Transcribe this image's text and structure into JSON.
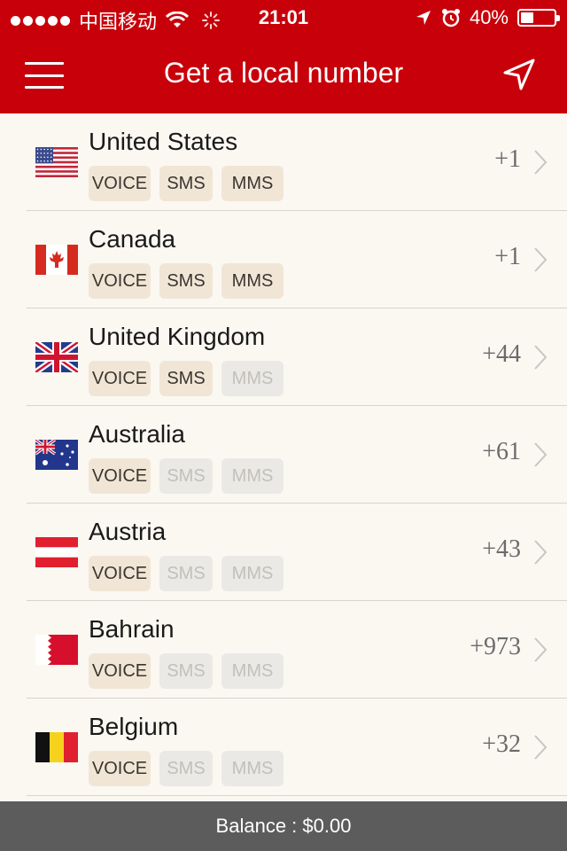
{
  "status_bar": {
    "carrier": "中国移动",
    "time": "21:01",
    "battery": "40%",
    "battery_level": 0.4
  },
  "header": {
    "title": "Get a local number",
    "menu_icon": "hamburger-menu-icon",
    "locate_icon": "location-arrow-icon"
  },
  "countries": [
    {
      "name": "United States",
      "code": "+1",
      "flag": "us",
      "voice": "VOICE",
      "sms": "SMS",
      "mms": "MMS",
      "voice_on": true,
      "sms_on": true,
      "mms_on": true
    },
    {
      "name": "Canada",
      "code": "+1",
      "flag": "ca",
      "voice": "VOICE",
      "sms": "SMS",
      "mms": "MMS",
      "voice_on": true,
      "sms_on": true,
      "mms_on": true
    },
    {
      "name": "United Kingdom",
      "code": "+44",
      "flag": "gb",
      "voice": "VOICE",
      "sms": "SMS",
      "mms": "MMS",
      "voice_on": true,
      "sms_on": true,
      "mms_on": false
    },
    {
      "name": "Australia",
      "code": "+61",
      "flag": "au",
      "voice": "VOICE",
      "sms": "SMS",
      "mms": "MMS",
      "voice_on": true,
      "sms_on": false,
      "mms_on": false
    },
    {
      "name": "Austria",
      "code": "+43",
      "flag": "at",
      "voice": "VOICE",
      "sms": "SMS",
      "mms": "MMS",
      "voice_on": true,
      "sms_on": false,
      "mms_on": false
    },
    {
      "name": "Bahrain",
      "code": "+973",
      "flag": "bh",
      "voice": "VOICE",
      "sms": "SMS",
      "mms": "MMS",
      "voice_on": true,
      "sms_on": false,
      "mms_on": false
    },
    {
      "name": "Belgium",
      "code": "+32",
      "flag": "be",
      "voice": "VOICE",
      "sms": "SMS",
      "mms": "MMS",
      "voice_on": true,
      "sms_on": false,
      "mms_on": false
    }
  ],
  "footer": {
    "balance": "Balance : $0.00"
  },
  "colors": {
    "brand_red": "#c8000a",
    "badge_on": "#f1e6d6",
    "badge_off": "#ebe9e6",
    "footer_bg": "#5c5c5c"
  }
}
